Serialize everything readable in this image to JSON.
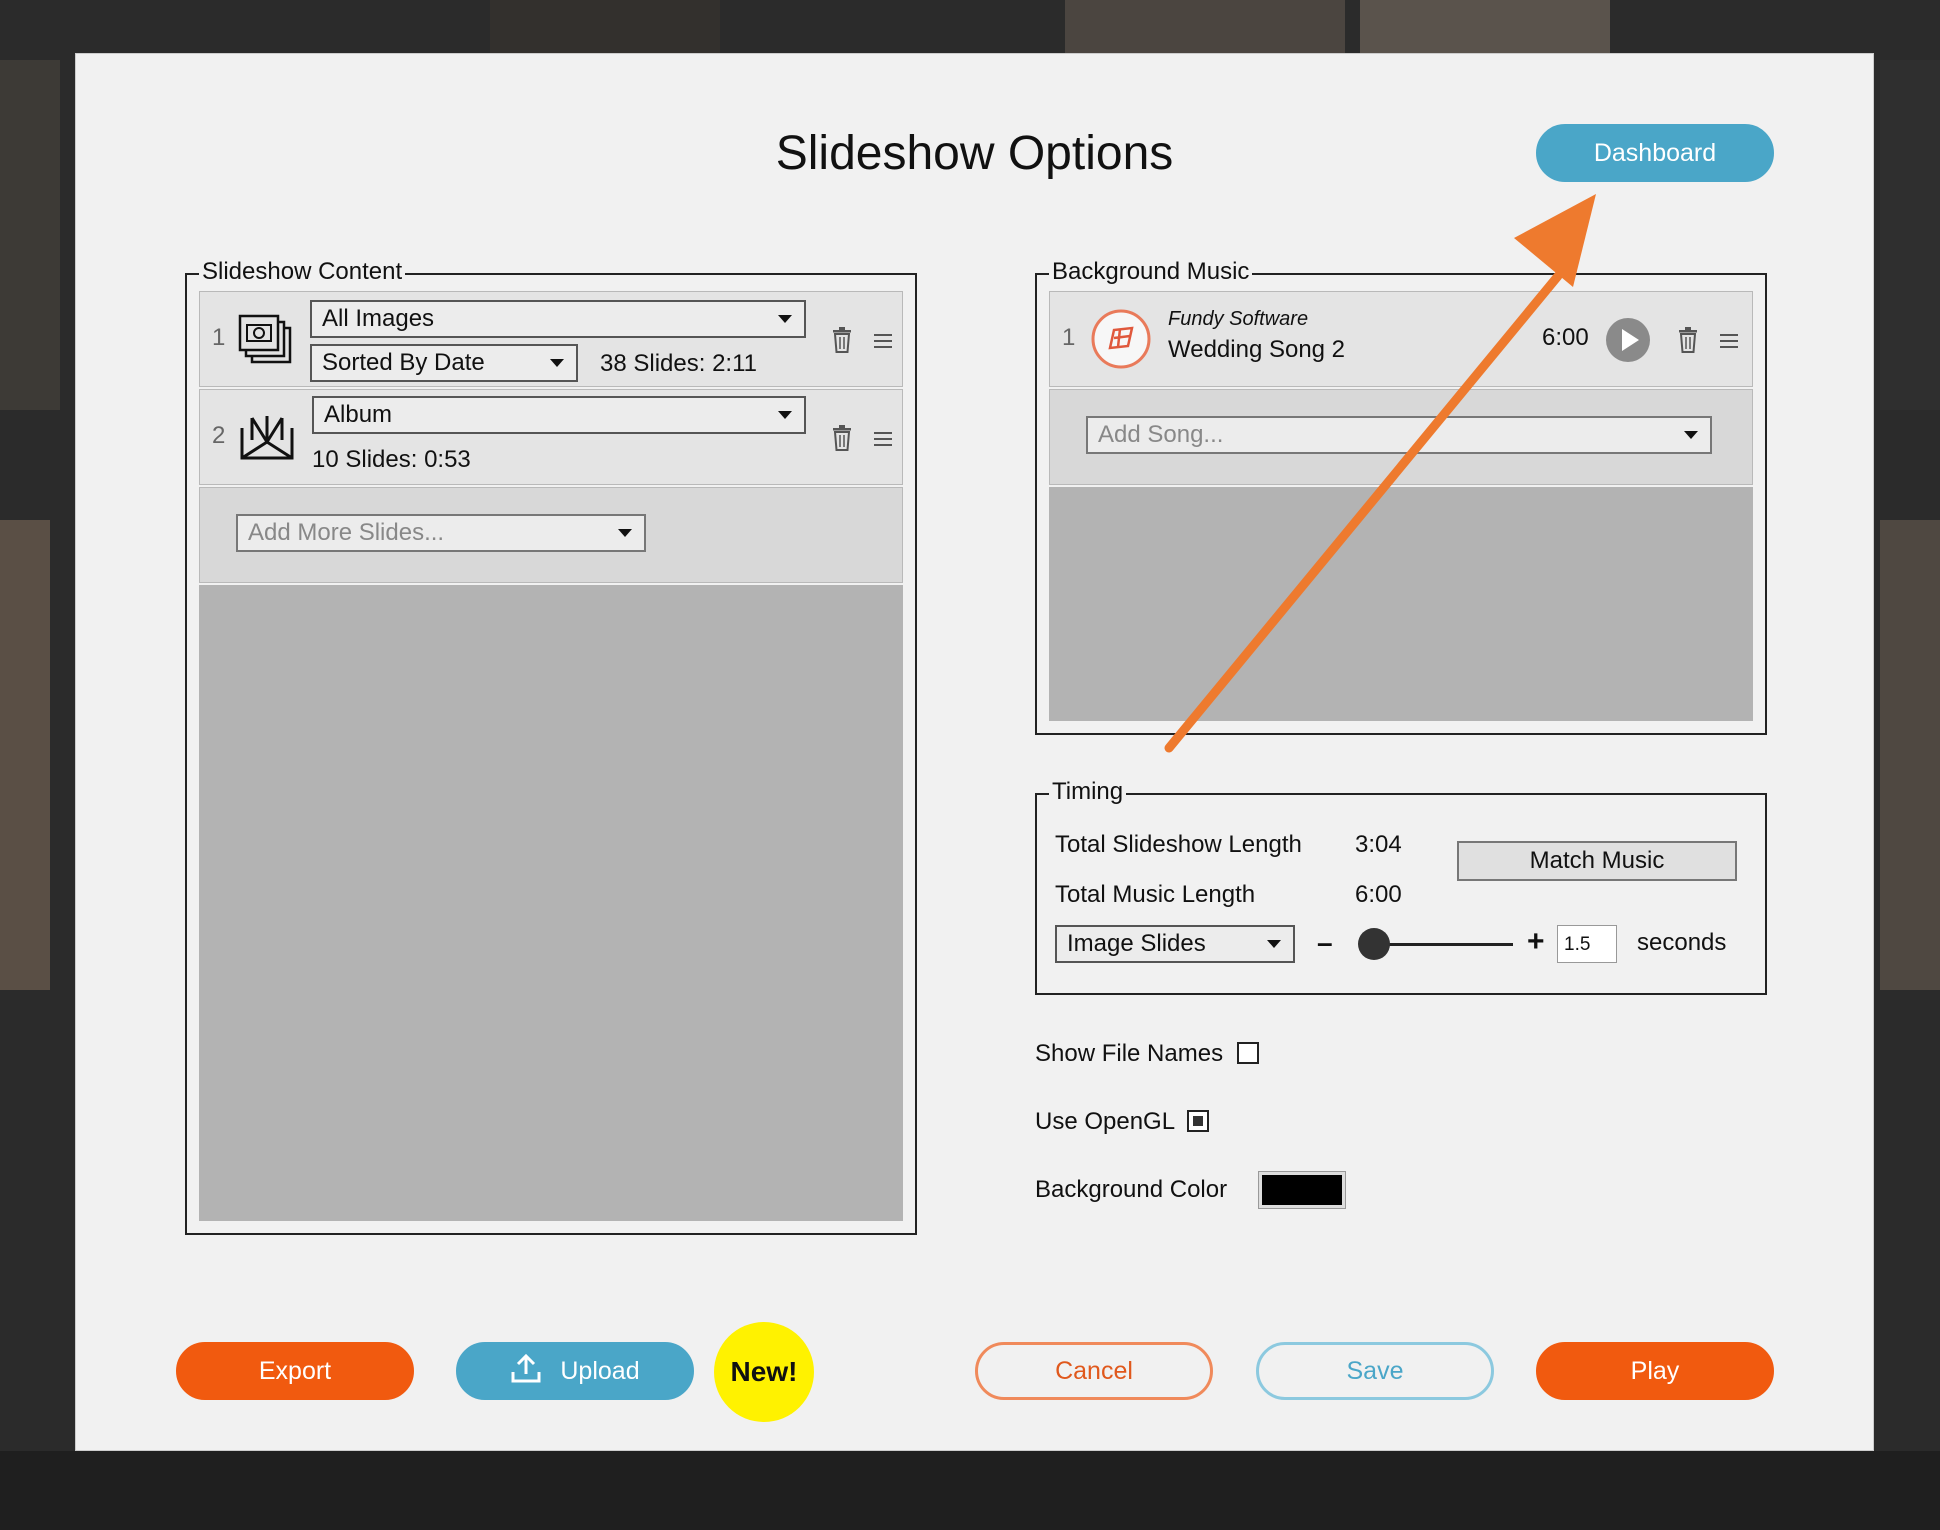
{
  "dialog": {
    "title": "Slideshow Options",
    "dashboard_label": "Dashboard"
  },
  "content": {
    "legend": "Slideshow Content",
    "items": [
      {
        "index": "1",
        "icon": "images-stack-icon",
        "source": "All Images",
        "sort": "Sorted By Date",
        "summary": "38 Slides: 2:11"
      },
      {
        "index": "2",
        "icon": "album-book-icon",
        "source": "Album",
        "summary": "10 Slides: 0:53"
      }
    ],
    "add_placeholder": "Add More Slides..."
  },
  "music": {
    "legend": "Background Music",
    "items": [
      {
        "index": "1",
        "artist": "Fundy Software",
        "title": "Wedding Song 2",
        "duration": "6:00"
      }
    ],
    "add_placeholder": "Add Song..."
  },
  "timing": {
    "legend": "Timing",
    "total_slideshow_label": "Total Slideshow Length",
    "total_slideshow_value": "3:04",
    "total_music_label": "Total Music Length",
    "total_music_value": "6:00",
    "match_music_label": "Match Music",
    "slide_type": "Image Slides",
    "minus": "–",
    "plus": "+",
    "seconds_value": "1.5",
    "seconds_label": "seconds",
    "slider_fraction": 0.1
  },
  "options": {
    "show_file_names_label": "Show File Names",
    "show_file_names_checked": false,
    "use_opengl_label": "Use OpenGL",
    "use_opengl_checked": true,
    "background_color_label": "Background Color",
    "background_color_value": "#000000"
  },
  "footer": {
    "export_label": "Export",
    "upload_label": "Upload",
    "new_badge": "New!",
    "cancel_label": "Cancel",
    "save_label": "Save",
    "play_label": "Play"
  },
  "colors": {
    "accent_orange": "#f15a0f",
    "accent_blue": "#4aa6c8",
    "annotation_arrow": "#ee7a2e"
  }
}
